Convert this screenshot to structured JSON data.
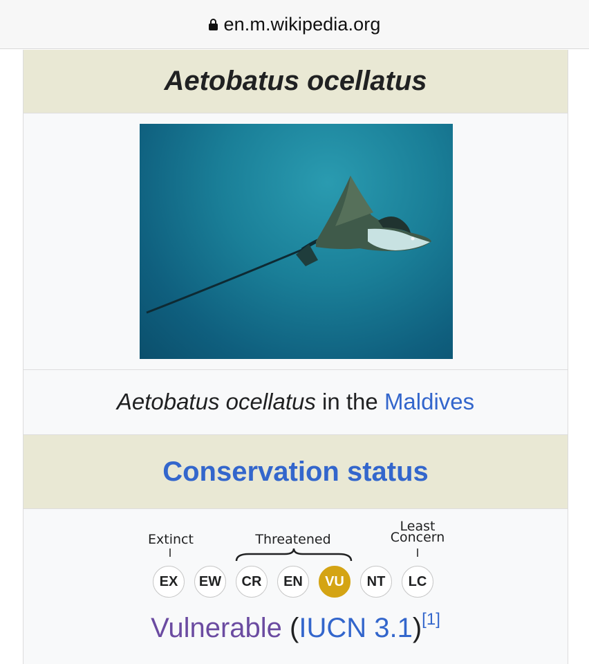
{
  "browser": {
    "url": "en.m.wikipedia.org",
    "lock_icon": "lock-icon"
  },
  "infobox": {
    "title": "Aetobatus ocellatus",
    "image_alt": "Aetobatus ocellatus in the Maldives",
    "caption": {
      "species": "Aetobatus ocellatus",
      "text": " in the ",
      "location": "Maldives"
    },
    "conservation_header": "Conservation status",
    "scale": {
      "group_labels": {
        "extinct": "Extinct",
        "threatened": "Threatened",
        "least_concern_1": "Least",
        "least_concern_2": "Concern"
      },
      "categories": [
        "EX",
        "EW",
        "CR",
        "EN",
        "VU",
        "NT",
        "LC"
      ],
      "selected": "VU",
      "selected_color": "#d4a414"
    },
    "status": {
      "label": "Vulnerable",
      "open": " (",
      "source": "IUCN 3.1",
      "close": ")",
      "ref": "[1]"
    }
  }
}
